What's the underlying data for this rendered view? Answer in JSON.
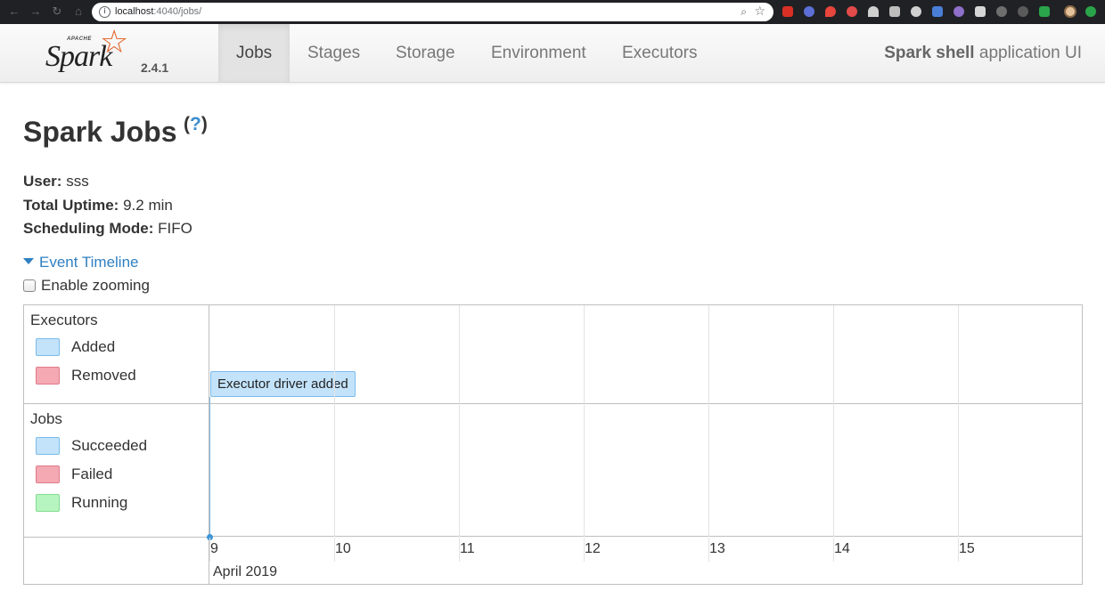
{
  "browser": {
    "url_host": "localhost",
    "url_rest": ":4040/jobs/"
  },
  "navbar": {
    "brand_apache": "APACHE",
    "brand_name": "Spark",
    "version": "2.4.1",
    "tabs": [
      {
        "label": "Jobs",
        "active": true
      },
      {
        "label": "Stages",
        "active": false
      },
      {
        "label": "Storage",
        "active": false
      },
      {
        "label": "Environment",
        "active": false
      },
      {
        "label": "Executors",
        "active": false
      }
    ],
    "app_name_bold": "Spark shell",
    "app_name_rest": " application UI"
  },
  "page": {
    "title": "Spark Jobs",
    "help_open": "(",
    "help_q": "?",
    "help_close": ")",
    "user_label": "User:",
    "user_value": " sss",
    "uptime_label": "Total Uptime:",
    "uptime_value": " 9.2 min",
    "scheduling_label": "Scheduling Mode:",
    "scheduling_value": " FIFO",
    "event_timeline": "Event Timeline",
    "enable_zooming": "Enable zooming"
  },
  "timeline": {
    "executors_title": "Executors",
    "executors_legend": [
      {
        "label": "Added",
        "color": "#c3e3fb",
        "border": "#7dbbe8"
      },
      {
        "label": "Removed",
        "color": "#f4a9b3",
        "border": "#e07a88"
      }
    ],
    "jobs_title": "Jobs",
    "jobs_legend": [
      {
        "label": "Succeeded",
        "color": "#c3e3fb",
        "border": "#7dbbe8"
      },
      {
        "label": "Failed",
        "color": "#f4a9b3",
        "border": "#e07a88"
      },
      {
        "label": "Running",
        "color": "#b7f5c0",
        "border": "#82dc92"
      }
    ],
    "axis_labels": [
      "9",
      "10",
      "11",
      "12",
      "13",
      "14",
      "15"
    ],
    "axis_month": "April 2019",
    "event_label": "Executor driver added"
  }
}
